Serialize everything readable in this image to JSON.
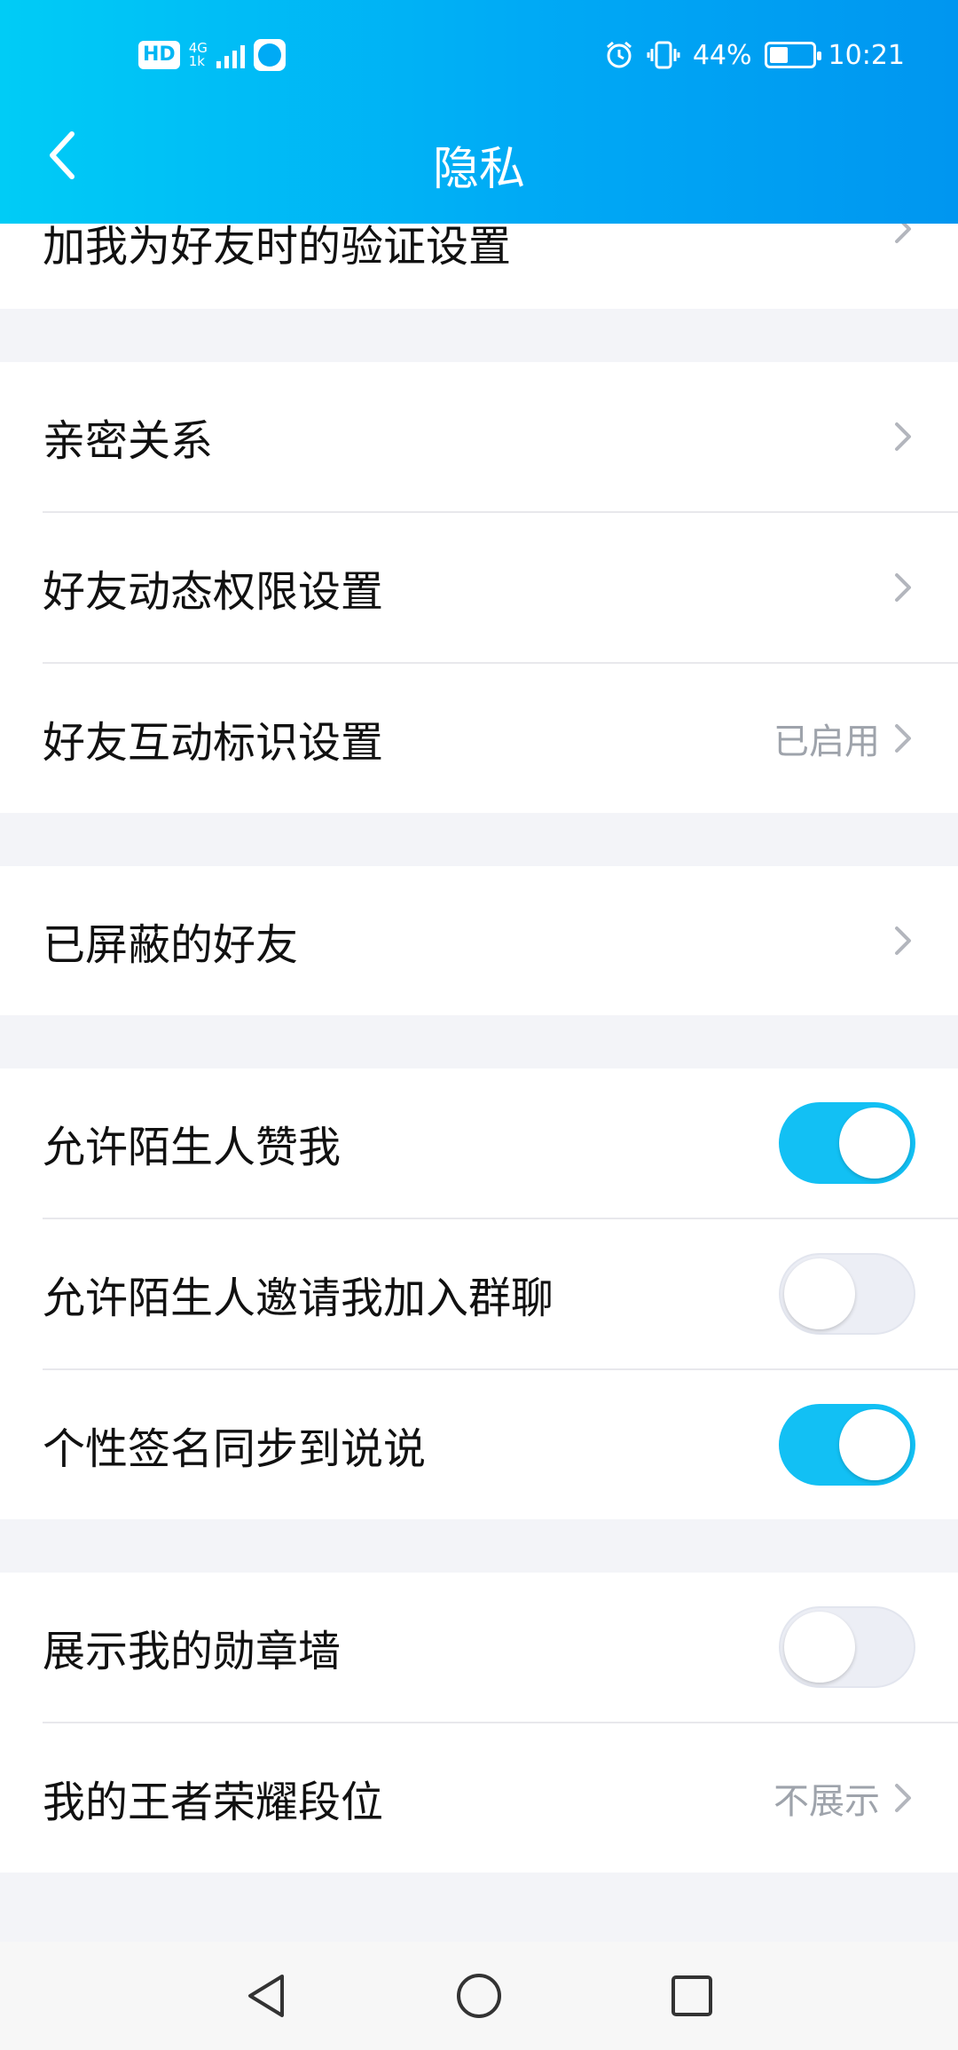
{
  "status_bar": {
    "hd": "HD",
    "network": "4G",
    "network_sub": "1k",
    "battery_percent": "44%",
    "time": "10:21"
  },
  "header": {
    "title": "隐私"
  },
  "groups": [
    {
      "rows": [
        {
          "label": "加我为好友时的验证设置",
          "value": "",
          "type": "nav"
        }
      ]
    },
    {
      "rows": [
        {
          "label": "亲密关系",
          "value": "",
          "type": "nav"
        },
        {
          "label": "好友动态权限设置",
          "value": "",
          "type": "nav"
        },
        {
          "label": "好友互动标识设置",
          "value": "已启用",
          "type": "nav"
        }
      ]
    },
    {
      "rows": [
        {
          "label": "已屏蔽的好友",
          "value": "",
          "type": "nav"
        }
      ]
    },
    {
      "rows": [
        {
          "label": "允许陌生人赞我",
          "type": "toggle",
          "on": true
        },
        {
          "label": "允许陌生人邀请我加入群聊",
          "type": "toggle",
          "on": false
        },
        {
          "label": "个性签名同步到说说",
          "type": "toggle",
          "on": true
        }
      ]
    },
    {
      "rows": [
        {
          "label": "展示我的勋章墙",
          "type": "toggle",
          "on": false
        },
        {
          "label": "我的王者荣耀段位",
          "value": "不展示",
          "type": "nav"
        }
      ]
    }
  ],
  "icons": {
    "back": "chevron-left-icon",
    "chevron": "chevron-right-icon",
    "nav_back": "triangle-back-icon",
    "nav_home": "circle-home-icon",
    "nav_recents": "square-recents-icon"
  },
  "colors": {
    "accent": "#00aaf5",
    "toggle_on": "#12c0f4",
    "toggle_off": "#eceef5"
  }
}
